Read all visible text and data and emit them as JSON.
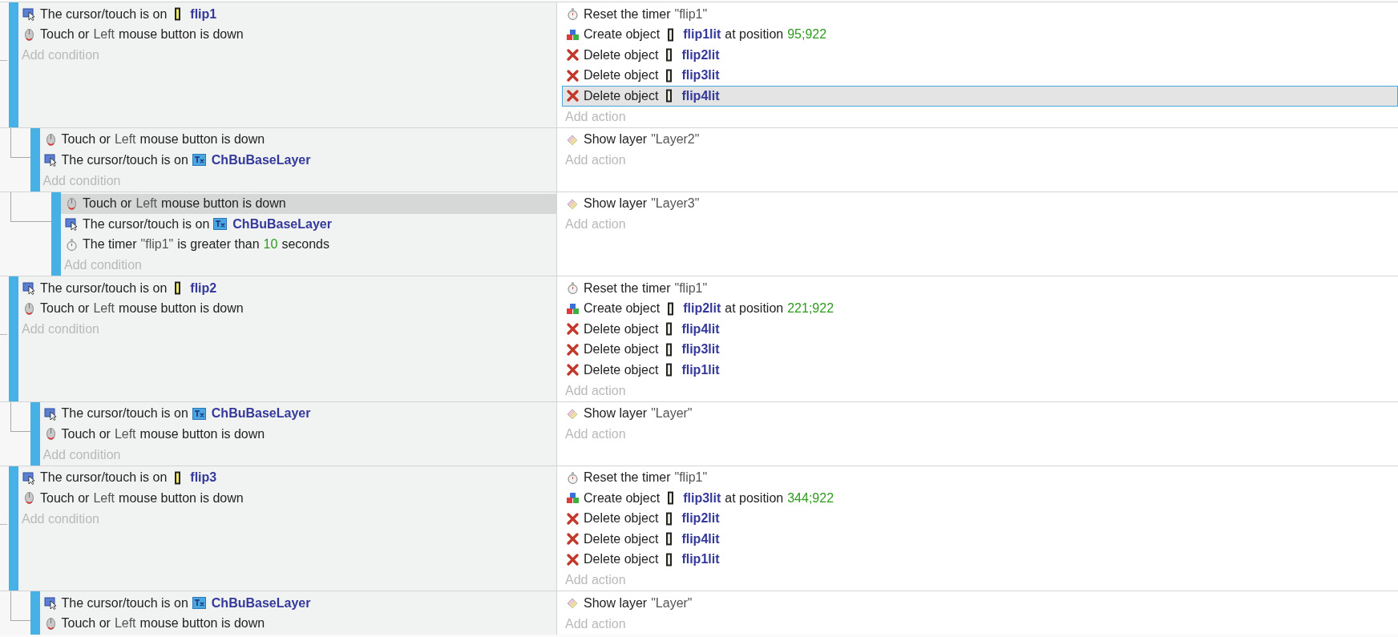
{
  "events": [
    {
      "conditions": [
        {
          "kind": "cursor",
          "selected": false,
          "parts": [
            {
              "kind": "text",
              "text": "The cursor/touch is on"
            },
            {
              "kind": "sprite",
              "text": "flip1"
            }
          ]
        },
        {
          "kind": "mouse",
          "selected": false,
          "parts": [
            {
              "kind": "text",
              "text": "Touch or"
            },
            {
              "kind": "param",
              "text": "Left"
            },
            {
              "kind": "text",
              "text": "mouse button is down"
            }
          ]
        }
      ],
      "add_condition": "Add condition",
      "actions": [
        {
          "kind": "timer",
          "selected": false,
          "parts": [
            {
              "kind": "text",
              "text": "Reset the timer"
            },
            {
              "kind": "param",
              "text": "\"flip1\""
            }
          ]
        },
        {
          "kind": "create",
          "selected": false,
          "parts": [
            {
              "kind": "text",
              "text": "Create object"
            },
            {
              "kind": "lit",
              "text": "flip1lit"
            },
            {
              "kind": "text",
              "text": "at position"
            },
            {
              "kind": "number",
              "text": "95;922"
            }
          ]
        },
        {
          "kind": "delete",
          "selected": false,
          "parts": [
            {
              "kind": "text",
              "text": "Delete object"
            },
            {
              "kind": "lit",
              "text": "flip2lit"
            }
          ]
        },
        {
          "kind": "delete",
          "selected": false,
          "parts": [
            {
              "kind": "text",
              "text": "Delete object"
            },
            {
              "kind": "lit",
              "text": "flip3lit"
            }
          ]
        },
        {
          "kind": "delete",
          "selected": true,
          "parts": [
            {
              "kind": "text",
              "text": "Delete object"
            },
            {
              "kind": "lit",
              "text": "flip4lit"
            }
          ]
        }
      ],
      "add_action": "Add action",
      "children": [
        {
          "conditions": [
            {
              "kind": "mouse",
              "selected": false,
              "parts": [
                {
                  "kind": "text",
                  "text": "Touch or"
                },
                {
                  "kind": "param",
                  "text": "Left"
                },
                {
                  "kind": "text",
                  "text": "mouse button is down"
                }
              ]
            },
            {
              "kind": "cursor",
              "selected": false,
              "parts": [
                {
                  "kind": "text",
                  "text": "The cursor/touch is on"
                },
                {
                  "kind": "textobject",
                  "text": "ChBuBaseLayer"
                }
              ]
            }
          ],
          "add_condition": "Add condition",
          "actions": [
            {
              "kind": "layer",
              "selected": false,
              "parts": [
                {
                  "kind": "text",
                  "text": "Show layer"
                },
                {
                  "kind": "param",
                  "text": "\"Layer2\""
                }
              ]
            }
          ],
          "add_action": "Add action",
          "children": [
            {
              "conditions": [
                {
                  "kind": "mouse",
                  "selected": true,
                  "parts": [
                    {
                      "kind": "text",
                      "text": "Touch or"
                    },
                    {
                      "kind": "param",
                      "text": "Left"
                    },
                    {
                      "kind": "text",
                      "text": "mouse button is down"
                    }
                  ]
                },
                {
                  "kind": "cursor",
                  "selected": false,
                  "parts": [
                    {
                      "kind": "text",
                      "text": "The cursor/touch is on"
                    },
                    {
                      "kind": "textobject",
                      "text": "ChBuBaseLayer"
                    }
                  ]
                },
                {
                  "kind": "timer",
                  "selected": false,
                  "parts": [
                    {
                      "kind": "text",
                      "text": "The timer"
                    },
                    {
                      "kind": "param",
                      "text": "\"flip1\""
                    },
                    {
                      "kind": "text",
                      "text": "is greater than"
                    },
                    {
                      "kind": "number",
                      "text": "10"
                    },
                    {
                      "kind": "text",
                      "text": "seconds"
                    }
                  ]
                }
              ],
              "add_condition": "Add condition",
              "actions": [
                {
                  "kind": "layer",
                  "selected": false,
                  "parts": [
                    {
                      "kind": "text",
                      "text": "Show layer"
                    },
                    {
                      "kind": "param",
                      "text": "\"Layer3\""
                    }
                  ]
                }
              ],
              "add_action": "Add action"
            }
          ]
        }
      ]
    },
    {
      "conditions": [
        {
          "kind": "cursor",
          "selected": false,
          "parts": [
            {
              "kind": "text",
              "text": "The cursor/touch is on"
            },
            {
              "kind": "sprite",
              "text": "flip2"
            }
          ]
        },
        {
          "kind": "mouse",
          "selected": false,
          "parts": [
            {
              "kind": "text",
              "text": "Touch or"
            },
            {
              "kind": "param",
              "text": "Left"
            },
            {
              "kind": "text",
              "text": "mouse button is down"
            }
          ]
        }
      ],
      "add_condition": "Add condition",
      "actions": [
        {
          "kind": "timer",
          "selected": false,
          "parts": [
            {
              "kind": "text",
              "text": "Reset the timer"
            },
            {
              "kind": "param",
              "text": "\"flip1\""
            }
          ]
        },
        {
          "kind": "create",
          "selected": false,
          "parts": [
            {
              "kind": "text",
              "text": "Create object"
            },
            {
              "kind": "lit",
              "text": "flip2lit"
            },
            {
              "kind": "text",
              "text": "at position"
            },
            {
              "kind": "number",
              "text": "221;922"
            }
          ]
        },
        {
          "kind": "delete",
          "selected": false,
          "parts": [
            {
              "kind": "text",
              "text": "Delete object"
            },
            {
              "kind": "lit",
              "text": "flip4lit"
            }
          ]
        },
        {
          "kind": "delete",
          "selected": false,
          "parts": [
            {
              "kind": "text",
              "text": "Delete object"
            },
            {
              "kind": "lit",
              "text": "flip3lit"
            }
          ]
        },
        {
          "kind": "delete",
          "selected": false,
          "parts": [
            {
              "kind": "text",
              "text": "Delete object"
            },
            {
              "kind": "lit",
              "text": "flip1lit"
            }
          ]
        }
      ],
      "add_action": "Add action",
      "children": [
        {
          "conditions": [
            {
              "kind": "cursor",
              "selected": false,
              "parts": [
                {
                  "kind": "text",
                  "text": "The cursor/touch is on"
                },
                {
                  "kind": "textobject",
                  "text": "ChBuBaseLayer"
                }
              ]
            },
            {
              "kind": "mouse",
              "selected": false,
              "parts": [
                {
                  "kind": "text",
                  "text": "Touch or"
                },
                {
                  "kind": "param",
                  "text": "Left"
                },
                {
                  "kind": "text",
                  "text": "mouse button is down"
                }
              ]
            }
          ],
          "add_condition": "Add condition",
          "actions": [
            {
              "kind": "layer",
              "selected": false,
              "parts": [
                {
                  "kind": "text",
                  "text": "Show layer"
                },
                {
                  "kind": "param",
                  "text": "\"Layer\""
                }
              ]
            }
          ],
          "add_action": "Add action"
        }
      ]
    },
    {
      "conditions": [
        {
          "kind": "cursor",
          "selected": false,
          "parts": [
            {
              "kind": "text",
              "text": "The cursor/touch is on"
            },
            {
              "kind": "sprite",
              "text": "flip3"
            }
          ]
        },
        {
          "kind": "mouse",
          "selected": false,
          "parts": [
            {
              "kind": "text",
              "text": "Touch or"
            },
            {
              "kind": "param",
              "text": "Left"
            },
            {
              "kind": "text",
              "text": "mouse button is down"
            }
          ]
        }
      ],
      "add_condition": "Add condition",
      "actions": [
        {
          "kind": "timer",
          "selected": false,
          "parts": [
            {
              "kind": "text",
              "text": "Reset the timer"
            },
            {
              "kind": "param",
              "text": "\"flip1\""
            }
          ]
        },
        {
          "kind": "create",
          "selected": false,
          "parts": [
            {
              "kind": "text",
              "text": "Create object"
            },
            {
              "kind": "lit",
              "text": "flip3lit"
            },
            {
              "kind": "text",
              "text": "at position"
            },
            {
              "kind": "number",
              "text": "344;922"
            }
          ]
        },
        {
          "kind": "delete",
          "selected": false,
          "parts": [
            {
              "kind": "text",
              "text": "Delete object"
            },
            {
              "kind": "lit",
              "text": "flip2lit"
            }
          ]
        },
        {
          "kind": "delete",
          "selected": false,
          "parts": [
            {
              "kind": "text",
              "text": "Delete object"
            },
            {
              "kind": "lit",
              "text": "flip4lit"
            }
          ]
        },
        {
          "kind": "delete",
          "selected": false,
          "parts": [
            {
              "kind": "text",
              "text": "Delete object"
            },
            {
              "kind": "lit",
              "text": "flip1lit"
            }
          ]
        }
      ],
      "add_action": "Add action",
      "children": [
        {
          "conditions": [
            {
              "kind": "cursor",
              "selected": false,
              "parts": [
                {
                  "kind": "text",
                  "text": "The cursor/touch is on"
                },
                {
                  "kind": "textobject",
                  "text": "ChBuBaseLayer"
                }
              ]
            },
            {
              "kind": "mouse",
              "selected": false,
              "parts": [
                {
                  "kind": "text",
                  "text": "Touch or"
                },
                {
                  "kind": "param",
                  "text": "Left"
                },
                {
                  "kind": "text",
                  "text": "mouse button is down"
                }
              ]
            }
          ],
          "actions": [
            {
              "kind": "layer",
              "selected": false,
              "parts": [
                {
                  "kind": "text",
                  "text": "Show layer"
                },
                {
                  "kind": "param",
                  "text": "\"Layer\""
                }
              ]
            }
          ],
          "add_action": "Add action"
        }
      ]
    }
  ]
}
